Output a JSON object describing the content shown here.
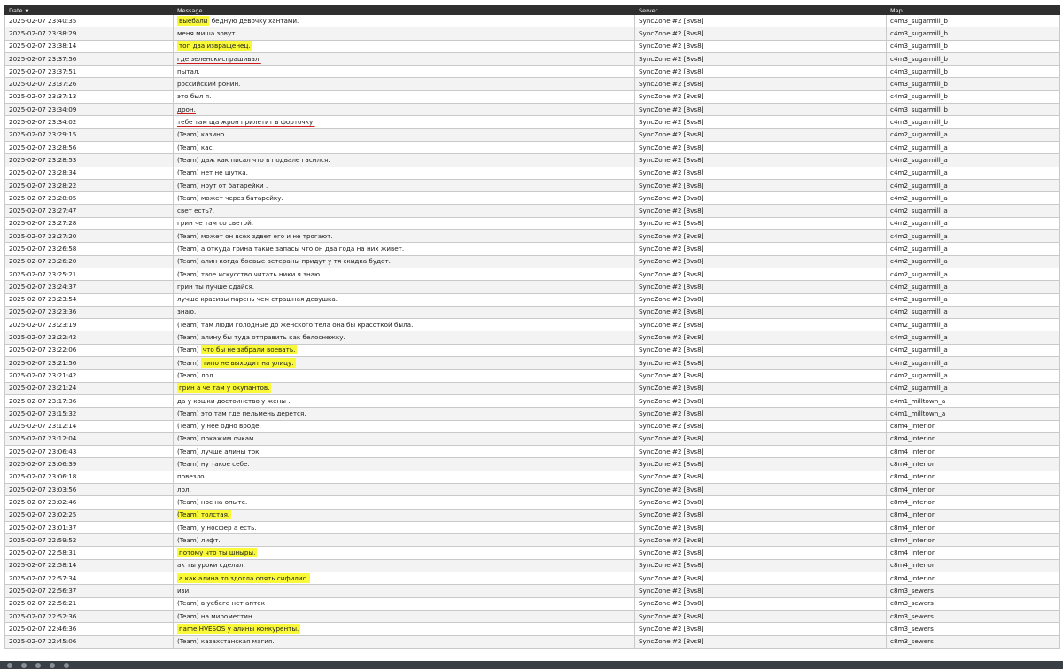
{
  "columns": {
    "date": "Date",
    "message": "Message",
    "server": "Server",
    "map": "Map"
  },
  "sort_indicator": "▼",
  "server_name": "SyncZone #2 [8vs8]",
  "highlight_color": "#f9f93a",
  "underline_color": "#d11a1a",
  "rows": [
    {
      "date": "2025-02-07 23:40:35",
      "hl": "выебали",
      "msg": " бедную девочку хантами.",
      "map": "c4m3_sugarmill_b"
    },
    {
      "date": "2025-02-07 23:38:29",
      "msg": "меня миша зовут.",
      "map": "c4m3_sugarmill_b"
    },
    {
      "date": "2025-02-07 23:38:14",
      "hl": "топ два извращенец.",
      "map": "c4m3_sugarmill_b"
    },
    {
      "date": "2025-02-07 23:37:56",
      "ul": "где зеленскиспрашивал.",
      "map": "c4m3_sugarmill_b"
    },
    {
      "date": "2025-02-07 23:37:51",
      "msg": "пытал.",
      "map": "c4m3_sugarmill_b"
    },
    {
      "date": "2025-02-07 23:37:26",
      "msg": "российский ронин.",
      "map": "c4m3_sugarmill_b"
    },
    {
      "date": "2025-02-07 23:37:13",
      "msg": "это был я.",
      "map": "c4m3_sugarmill_b"
    },
    {
      "date": "2025-02-07 23:34:09",
      "ul": "дрон.",
      "map": "c4m3_sugarmill_b"
    },
    {
      "date": "2025-02-07 23:34:02",
      "ul": "тебе там ща жрон прилетит в форточку.",
      "map": "c4m3_sugarmill_b"
    },
    {
      "date": "2025-02-07 23:29:15",
      "msg": "(Team) казино.",
      "map": "c4m2_sugarmill_a"
    },
    {
      "date": "2025-02-07 23:28:56",
      "msg": "(Team) кас.",
      "map": "c4m2_sugarmill_a"
    },
    {
      "date": "2025-02-07 23:28:53",
      "msg": "(Team) даж как писал что в подвале гасился.",
      "map": "c4m2_sugarmill_a"
    },
    {
      "date": "2025-02-07 23:28:34",
      "msg": "(Team) нет не шутка.",
      "map": "c4m2_sugarmill_a"
    },
    {
      "date": "2025-02-07 23:28:22",
      "msg": "(Team) ноут от батарейки .",
      "map": "c4m2_sugarmill_a"
    },
    {
      "date": "2025-02-07 23:28:05",
      "msg": "(Team) может через батарейку.",
      "map": "c4m2_sugarmill_a"
    },
    {
      "date": "2025-02-07 23:27:47",
      "msg": "свет есть?.",
      "map": "c4m2_sugarmill_a"
    },
    {
      "date": "2025-02-07 23:27:28",
      "msg": "грин че там со светой.",
      "map": "c4m2_sugarmill_a"
    },
    {
      "date": "2025-02-07 23:27:20",
      "msg": "(Team) может он всех здвет его и не трогают.",
      "map": "c4m2_sugarmill_a"
    },
    {
      "date": "2025-02-07 23:26:58",
      "msg": "(Team) а откуда грина такие запасы что он два года на них живет.",
      "map": "c4m2_sugarmill_a"
    },
    {
      "date": "2025-02-07 23:26:20",
      "msg": "(Team) алин когда боевые ветераны придут у тя скидка будет.",
      "map": "c4m2_sugarmill_a"
    },
    {
      "date": "2025-02-07 23:25:21",
      "msg": "(Team) твое искусство читать ники я знаю.",
      "map": "c4m2_sugarmill_a"
    },
    {
      "date": "2025-02-07 23:24:37",
      "msg": "грин ты лучше сдайся.",
      "map": "c4m2_sugarmill_a"
    },
    {
      "date": "2025-02-07 23:23:54",
      "msg": "лучше красивы парень чем страшная девушка.",
      "map": "c4m2_sugarmill_a"
    },
    {
      "date": "2025-02-07 23:23:36",
      "msg": "знаю.",
      "map": "c4m2_sugarmill_a"
    },
    {
      "date": "2025-02-07 23:23:19",
      "msg": "(Team) там люди голодные до женского тела она бы красоткой была.",
      "map": "c4m2_sugarmill_a"
    },
    {
      "date": "2025-02-07 23:22:42",
      "msg": "(Team) алину бы туда отправить как белоснежку.",
      "map": "c4m2_sugarmill_a"
    },
    {
      "date": "2025-02-07 23:22:06",
      "pre": "(Team) ",
      "hl": "что бы не забрали воевать.",
      "map": "c4m2_sugarmill_a"
    },
    {
      "date": "2025-02-07 23:21:56",
      "pre": "(Team) ",
      "hl": "типо не выходит на улицу.",
      "map": "c4m2_sugarmill_a"
    },
    {
      "date": "2025-02-07 23:21:42",
      "msg": "(Team) лол.",
      "map": "c4m2_sugarmill_a"
    },
    {
      "date": "2025-02-07 23:21:24",
      "hl": "грин а че там у окупантов.",
      "map": "c4m2_sugarmill_a"
    },
    {
      "date": "2025-02-07 23:17:36",
      "msg": "да у кошки достоинство у жены .",
      "map": "c4m1_milltown_a"
    },
    {
      "date": "2025-02-07 23:15:32",
      "msg": "(Team) это там где пельмень дерется.",
      "map": "c4m1_milltown_a"
    },
    {
      "date": "2025-02-07 23:12:14",
      "msg": "(Team) у нее одно вроде.",
      "map": "c8m4_interior"
    },
    {
      "date": "2025-02-07 23:12:04",
      "msg": "(Team) покажим очкам.",
      "map": "c8m4_interior"
    },
    {
      "date": "2025-02-07 23:06:43",
      "msg": "(Team) лучше алины ток.",
      "map": "c8m4_interior"
    },
    {
      "date": "2025-02-07 23:06:39",
      "msg": "(Team) ну такое себе.",
      "map": "c8m4_interior"
    },
    {
      "date": "2025-02-07 23:06:18",
      "msg": "повезло.",
      "map": "c8m4_interior"
    },
    {
      "date": "2025-02-07 23:03:56",
      "msg": "лол.",
      "map": "c8m4_interior"
    },
    {
      "date": "2025-02-07 23:02:46",
      "msg": "(Team) нос на опыте.",
      "map": "c8m4_interior"
    },
    {
      "date": "2025-02-07 23:02:25",
      "msg": "(Team) толстая.",
      "hlall": true,
      "map": "c8m4_interior"
    },
    {
      "date": "2025-02-07 23:01:37",
      "msg": "(Team) у носфер а есть.",
      "map": "c8m4_interior"
    },
    {
      "date": "2025-02-07 22:59:52",
      "msg": "(Team) лифт.",
      "map": "c8m4_interior"
    },
    {
      "date": "2025-02-07 22:58:31",
      "hl": "потому что ты шныры.",
      "map": "c8m4_interior"
    },
    {
      "date": "2025-02-07 22:58:14",
      "msg": "ак ты уроки сделал.",
      "map": "c8m4_interior"
    },
    {
      "date": "2025-02-07 22:57:34",
      "hl": "а как алина то здохла опять сифилис.",
      "map": "c8m4_interior"
    },
    {
      "date": "2025-02-07 22:56:37",
      "msg": "изи.",
      "map": "c8m3_sewers"
    },
    {
      "date": "2025-02-07 22:56:21",
      "msg": "(Team) в уебеге нет аптек .",
      "map": "c8m3_sewers"
    },
    {
      "date": "2025-02-07 22:52:36",
      "msg": "(Team) на мироместин.",
      "map": "c8m3_sewers"
    },
    {
      "date": "2025-02-07 22:46:36",
      "hl": "name HVESOS у алины конкуренты.",
      "map": "c8m3_sewers"
    },
    {
      "date": "2025-02-07 22:45:06",
      "msg": "(Team) казахстанская магия.",
      "map": "c8m3_sewers"
    }
  ]
}
